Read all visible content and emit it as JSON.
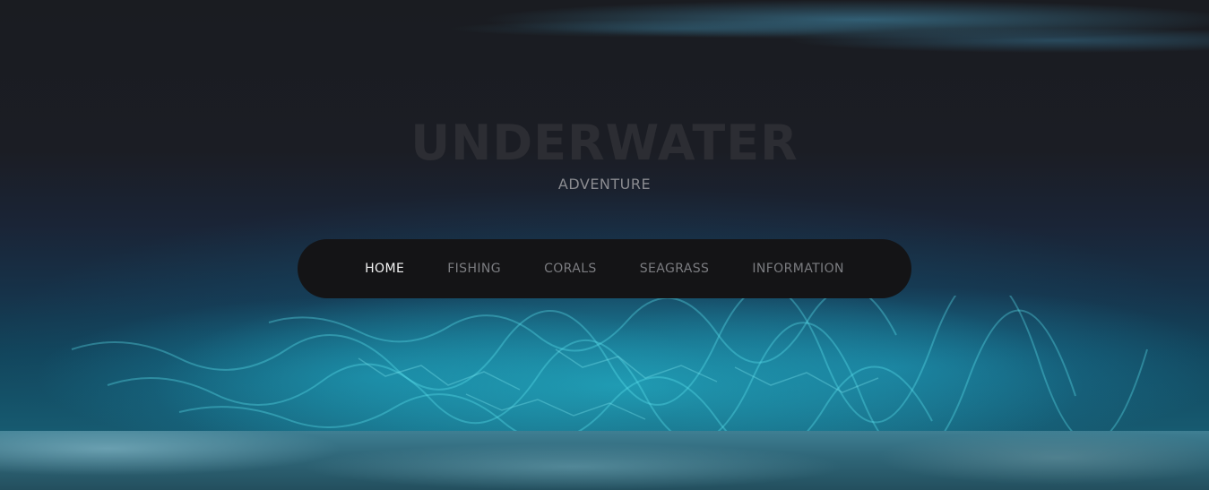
{
  "header": {
    "title": "UNDERWATER",
    "subtitle": "ADVENTURE"
  },
  "nav": {
    "items": [
      {
        "label": "HOME",
        "active": true
      },
      {
        "label": "FISHING",
        "active": false
      },
      {
        "label": "CORALS",
        "active": false
      },
      {
        "label": "SEAGRASS",
        "active": false
      },
      {
        "label": "INFORMATION",
        "active": false
      }
    ]
  },
  "colors": {
    "title": "#2c2d33",
    "subtitle": "#8a8b90",
    "nav_background": "#141416",
    "nav_active": "#f4f4f4",
    "nav_inactive": "#7b7c80",
    "water_accent": "#28c8dc"
  }
}
